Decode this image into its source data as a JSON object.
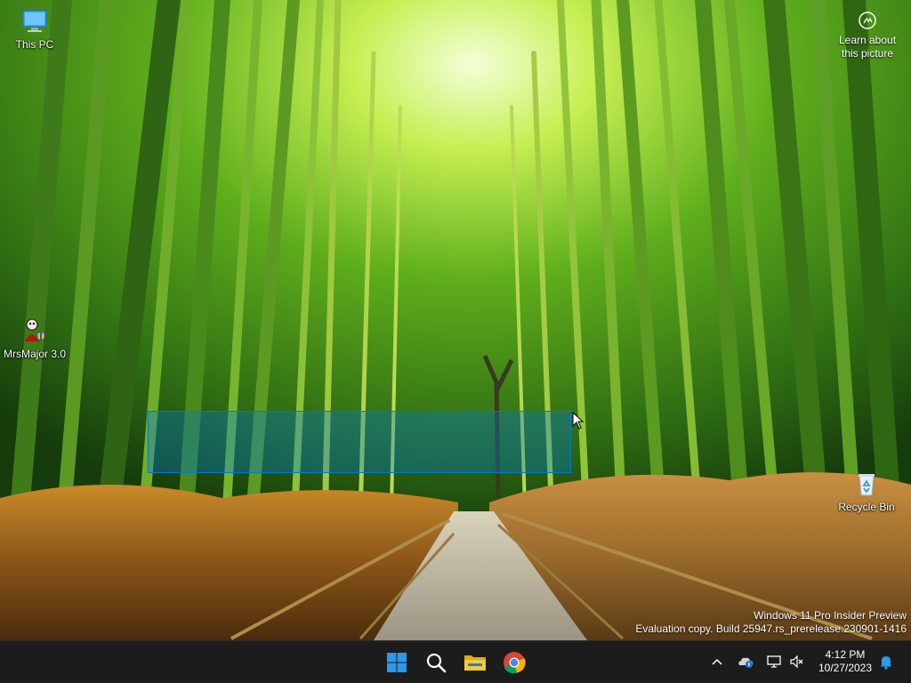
{
  "desktop": {
    "icons": [
      {
        "label": "This PC",
        "icon": "this-pc-icon"
      },
      {
        "label": "MrsMajor 3.0",
        "icon": "mrsmajor-icon"
      },
      {
        "label": "Recycle Bin",
        "icon": "recycle-bin-icon"
      }
    ],
    "learn_about": {
      "line1": "Learn about",
      "line2": "this picture",
      "icon": "camera-info-icon"
    },
    "watermark": {
      "line1": "Windows 11 Pro Insider Preview",
      "line2": "Evaluation copy. Build 25947.rs_prerelease.230901-1416"
    }
  },
  "taskbar": {
    "apps": [
      {
        "name": "start",
        "icon": "windows-logo-icon"
      },
      {
        "name": "search",
        "icon": "search-icon"
      },
      {
        "name": "file-explorer",
        "icon": "folder-icon"
      },
      {
        "name": "chrome",
        "icon": "chrome-icon"
      }
    ],
    "tray": {
      "icons": [
        "chevron-up-icon",
        "onedrive-icon",
        "network-icon",
        "volume-muted-icon",
        "notification-bell-icon"
      ],
      "time": "4:12 PM",
      "date": "10/27/2023"
    }
  },
  "colors": {
    "taskbar_bg": "#1c1c1c",
    "selection_fill": "#0078d7",
    "windows_blue": "#2b9ae8"
  }
}
